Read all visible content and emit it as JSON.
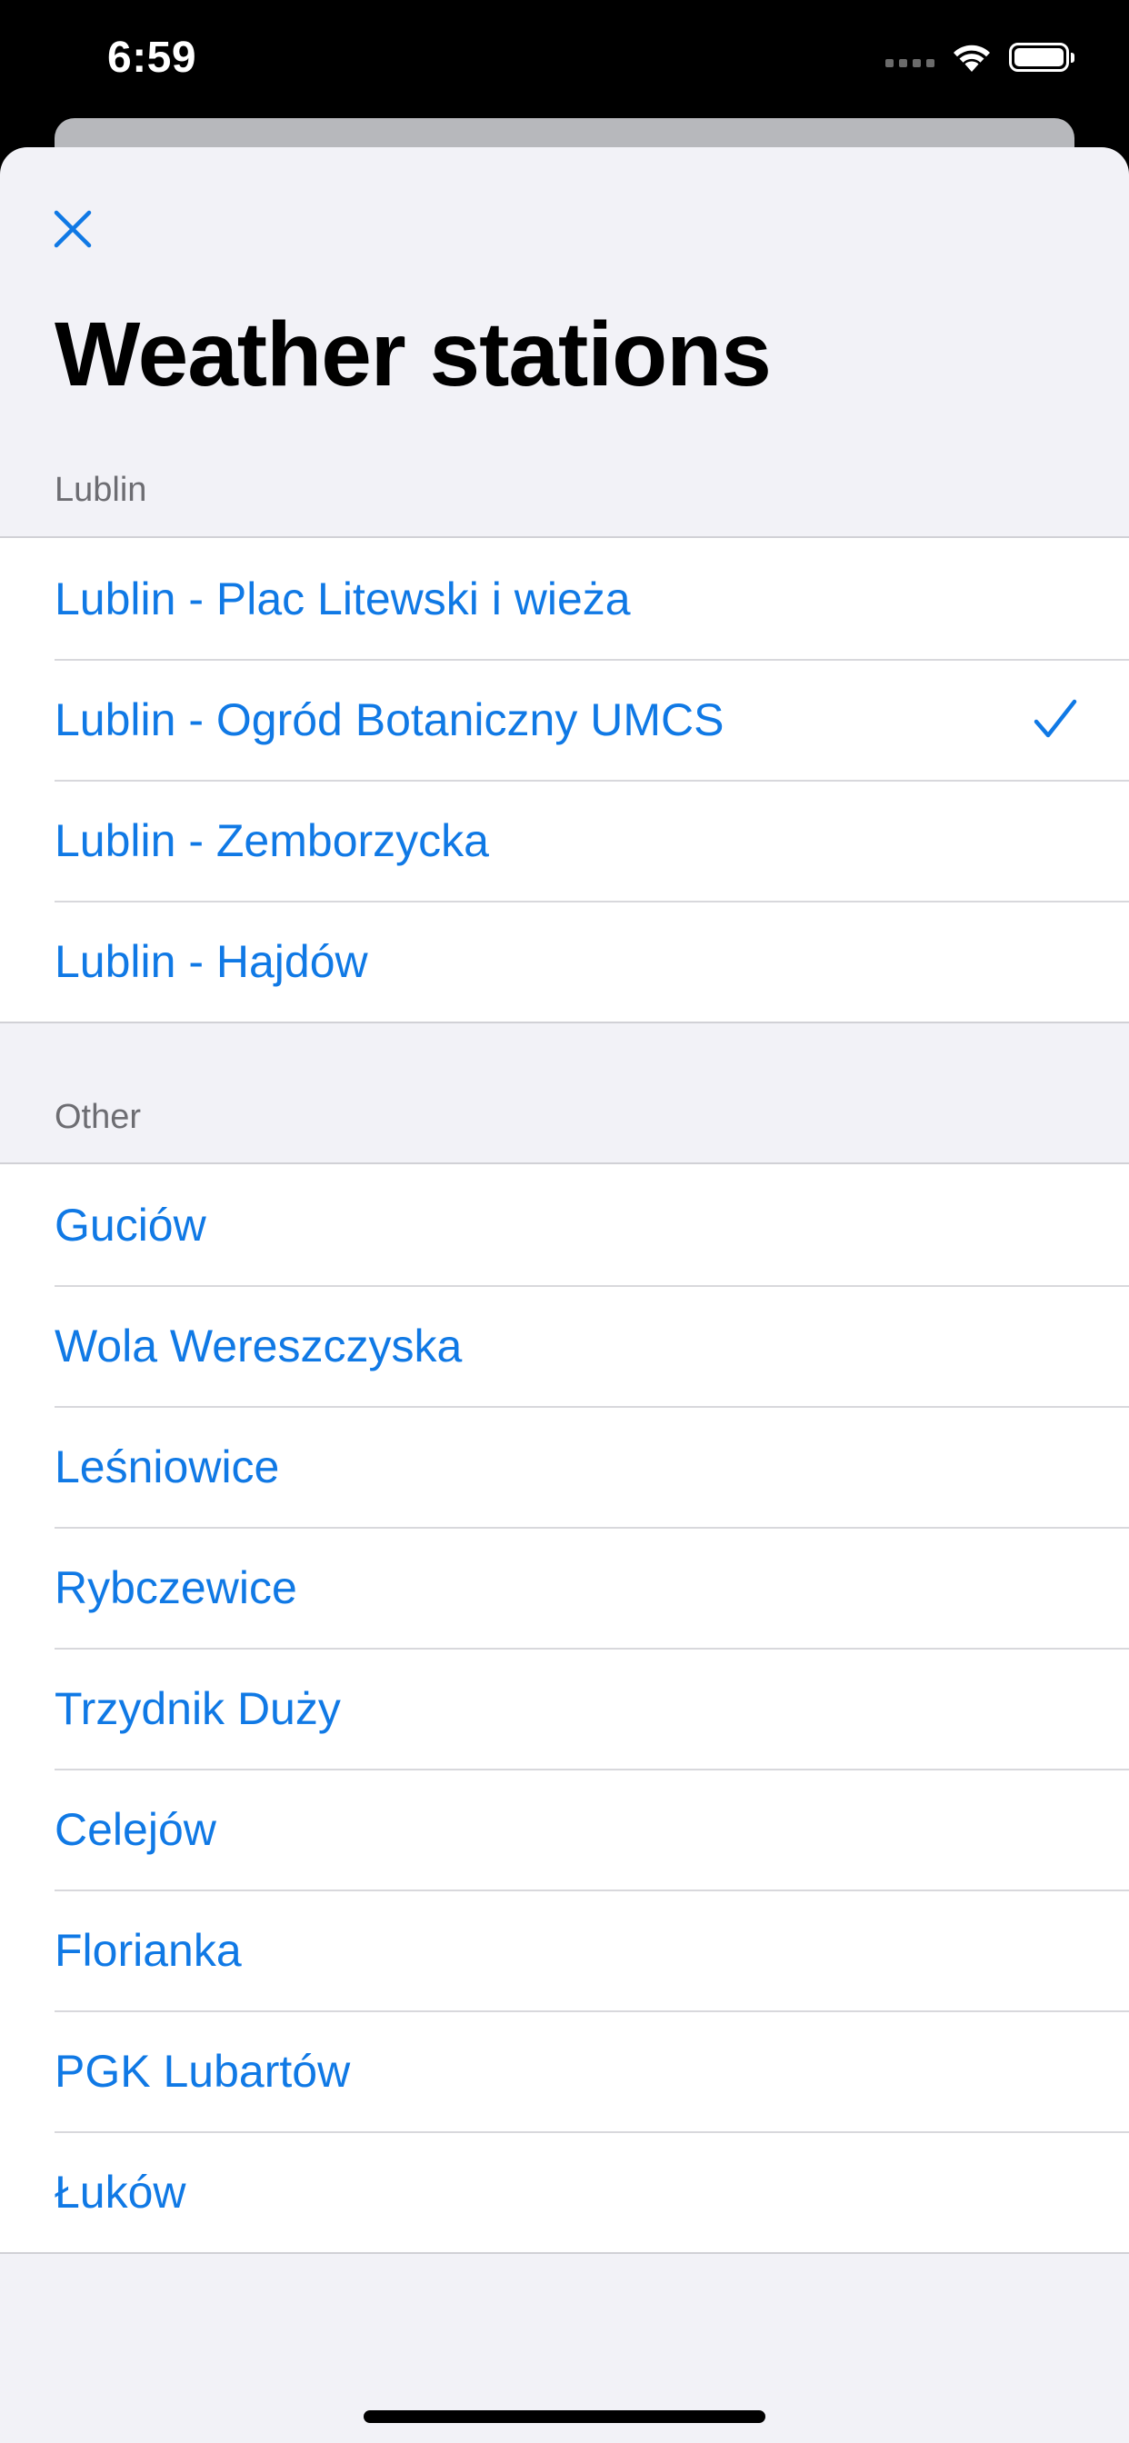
{
  "status_bar": {
    "time": "6:59",
    "icons": [
      "cellular-signal-icon",
      "wifi-icon",
      "battery-icon"
    ]
  },
  "sheet": {
    "close_icon": "close-icon",
    "title": "Weather stations"
  },
  "sections": [
    {
      "header": "Lublin",
      "items": [
        {
          "label": "Lublin - Plac Litewski i wieża",
          "selected": false
        },
        {
          "label": "Lublin - Ogród Botaniczny UMCS",
          "selected": true
        },
        {
          "label": "Lublin - Zemborzycka",
          "selected": false
        },
        {
          "label": "Lublin - Hajdów",
          "selected": false
        }
      ]
    },
    {
      "header": "Other",
      "items": [
        {
          "label": "Guciów",
          "selected": false
        },
        {
          "label": "Wola Wereszczyska",
          "selected": false
        },
        {
          "label": "Leśniowice",
          "selected": false
        },
        {
          "label": "Rybczewice",
          "selected": false
        },
        {
          "label": "Trzydnik Duży",
          "selected": false
        },
        {
          "label": "Celejów",
          "selected": false
        },
        {
          "label": "Florianka",
          "selected": false
        },
        {
          "label": "PGK Lubartów",
          "selected": false
        },
        {
          "label": "Łuków",
          "selected": false
        }
      ]
    }
  ],
  "colors": {
    "accent": "#1079e5",
    "sheet_background": "#f2f2f7",
    "row_background": "#ffffff",
    "section_header": "#6d6d72"
  }
}
